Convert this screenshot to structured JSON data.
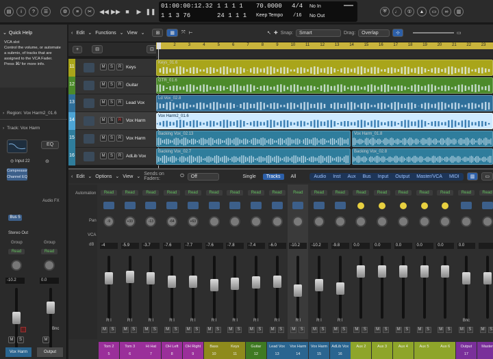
{
  "topbar": {
    "lcd": {
      "smpte": "01:00:00:12.32",
      "beats_top": "1  1  1     1",
      "beats_bottom": "24  1  1     1",
      "bars_bottom": "1  1  3     76",
      "tempo": "70.0000",
      "tempo_mode": "Keep Tempo",
      "sig_top": "4/4",
      "sig_bottom": "/16",
      "in": "No In",
      "out": "No Out"
    }
  },
  "quickhelp": {
    "title": "Quick Help",
    "body": "VCA slot\nControl the volume, or automate a submix, of tracks that are assigned to the VCA Fader.\nPress ⌘/ for more info."
  },
  "inspector": {
    "region": "Region:  Vox Harm2_01.6",
    "track": "Track:  Vox Harm",
    "eq": "EQ",
    "input": "Input 22",
    "plugins": [
      "Compressor",
      "Channel EQ"
    ],
    "audiofx": "Audio FX",
    "bus": "Bus 5",
    "stereo_out": "Stereo Out",
    "group": "Group",
    "read": "Read",
    "db_left": "-10.2",
    "db_right": "0.0",
    "bnc": "Bnc",
    "name_left": "Vox Harm",
    "name_right": "Output"
  },
  "tracks_toolbar": {
    "edit": "Edit",
    "functions": "Functions",
    "view": "View",
    "snap_label": "Snap:",
    "snap_value": "Smart",
    "drag_label": "Drag:",
    "drag_value": "Overlap"
  },
  "ruler": [
    "1",
    "2",
    "3",
    "4",
    "5",
    "6",
    "7",
    "8",
    "9",
    "10",
    "11",
    "12",
    "13",
    "14",
    "15",
    "16",
    "17",
    "18",
    "19",
    "20",
    "21",
    "22",
    "23"
  ],
  "tracks": [
    {
      "num": "11",
      "name": "Keys",
      "color": "#a9a51a",
      "region": "Keys_01.6"
    },
    {
      "num": "12",
      "name": "Guitar",
      "color": "#4c8a2a",
      "region": "GTR_01.6"
    },
    {
      "num": "13",
      "name": "Lead Vox",
      "color": "#2f6f9a",
      "region": "Ld Vox_02.8"
    },
    {
      "num": "14",
      "name": "Vox Harm",
      "color": "#4da4d4",
      "region": "Vox Harm2_01.6"
    },
    {
      "num": "15",
      "name": "Vox Harm",
      "color": "#2f7d9c",
      "region": "Backing Vox_02.13",
      "region2": "Vox Harm_01.8"
    },
    {
      "num": "16",
      "name": "AdLib Vox",
      "color": "#2f7d9c",
      "region": "Backing Vox_02.7",
      "region2": "Backing Vox_02.8"
    }
  ],
  "mixer": {
    "edit": "Edit",
    "options": "Options",
    "view": "View",
    "sends_label": "Sends on Faders:",
    "sends_value": "Off",
    "modes": [
      "Single",
      "Tracks",
      "All"
    ],
    "filters": [
      "Audio",
      "Inst",
      "Aux",
      "Bus",
      "Input",
      "Output",
      "Master/VCA",
      "MIDI"
    ],
    "row_labels": {
      "automation": "Automation",
      "pan": "Pan",
      "vca": "VCA",
      "db": "dB"
    },
    "strips": [
      {
        "name": "Tom 2",
        "num": "5",
        "db": "-4",
        "pan": "-9",
        "color": "#9a2f9a",
        "read": "Read"
      },
      {
        "name": "Tom 3",
        "num": "6",
        "db": "-5.9",
        "pan": "+33",
        "color": "#9a2f9a",
        "read": "Read"
      },
      {
        "name": "Hi Hat",
        "num": "7",
        "db": "-3.7",
        "pan": "-13",
        "color": "#9a2f9a",
        "read": "Read"
      },
      {
        "name": "OH Left",
        "num": "8",
        "db": "-7.6",
        "pan": "-64",
        "color": "#9a2f9a",
        "read": "Read"
      },
      {
        "name": "OH Right",
        "num": "9",
        "db": "-7.7",
        "pan": "+63",
        "color": "#9a2f9a",
        "read": "Read"
      },
      {
        "name": "Bass",
        "num": "10",
        "db": "-7.6",
        "pan": "",
        "color": "#8e8a1c",
        "read": "Read"
      },
      {
        "name": "Keys",
        "num": "11",
        "db": "-7.8",
        "pan": "",
        "color": "#8e8a1c",
        "read": "Read"
      },
      {
        "name": "Guitar",
        "num": "12",
        "db": "-7.4",
        "pan": "",
        "color": "#3f7a22",
        "read": "Read"
      },
      {
        "name": "Lead Vox",
        "num": "13",
        "db": "-6.0",
        "pan": "",
        "color": "#2a6590",
        "read": "Read"
      },
      {
        "name": "Vox Harm",
        "num": "14",
        "db": "-10.2",
        "pan": "",
        "color": "#2a6590",
        "read": "Read"
      },
      {
        "name": "Vox Harm",
        "num": "15",
        "db": "-10.2",
        "pan": "",
        "color": "#2a6590",
        "read": "Read"
      },
      {
        "name": "AdLib Vox",
        "num": "16",
        "db": "-9.8",
        "pan": "",
        "color": "#2a6590",
        "read": "Read"
      },
      {
        "name": "Aux 2",
        "num": "",
        "db": "0.0",
        "pan": "",
        "color": "#8ea52a",
        "read": "Read"
      },
      {
        "name": "Aux 3",
        "num": "",
        "db": "0.0",
        "pan": "",
        "color": "#8ea52a",
        "read": "Read"
      },
      {
        "name": "Aux 4",
        "num": "",
        "db": "0.0",
        "pan": "",
        "color": "#8ea52a",
        "read": "Read"
      },
      {
        "name": "Aux 5",
        "num": "",
        "db": "0.0",
        "pan": "",
        "color": "#8ea52a",
        "read": "Read"
      },
      {
        "name": "Aux 6",
        "num": "",
        "db": "0.0",
        "pan": "",
        "color": "#8ea52a",
        "read": "Read"
      },
      {
        "name": "Output",
        "num": "17",
        "db": "0.0",
        "pan": "",
        "color": "#7a2f9a",
        "read": "Read"
      },
      {
        "name": "Master",
        "num": "",
        "db": "",
        "pan": "",
        "color": "#7a2f9a",
        "read": "Read"
      }
    ]
  }
}
